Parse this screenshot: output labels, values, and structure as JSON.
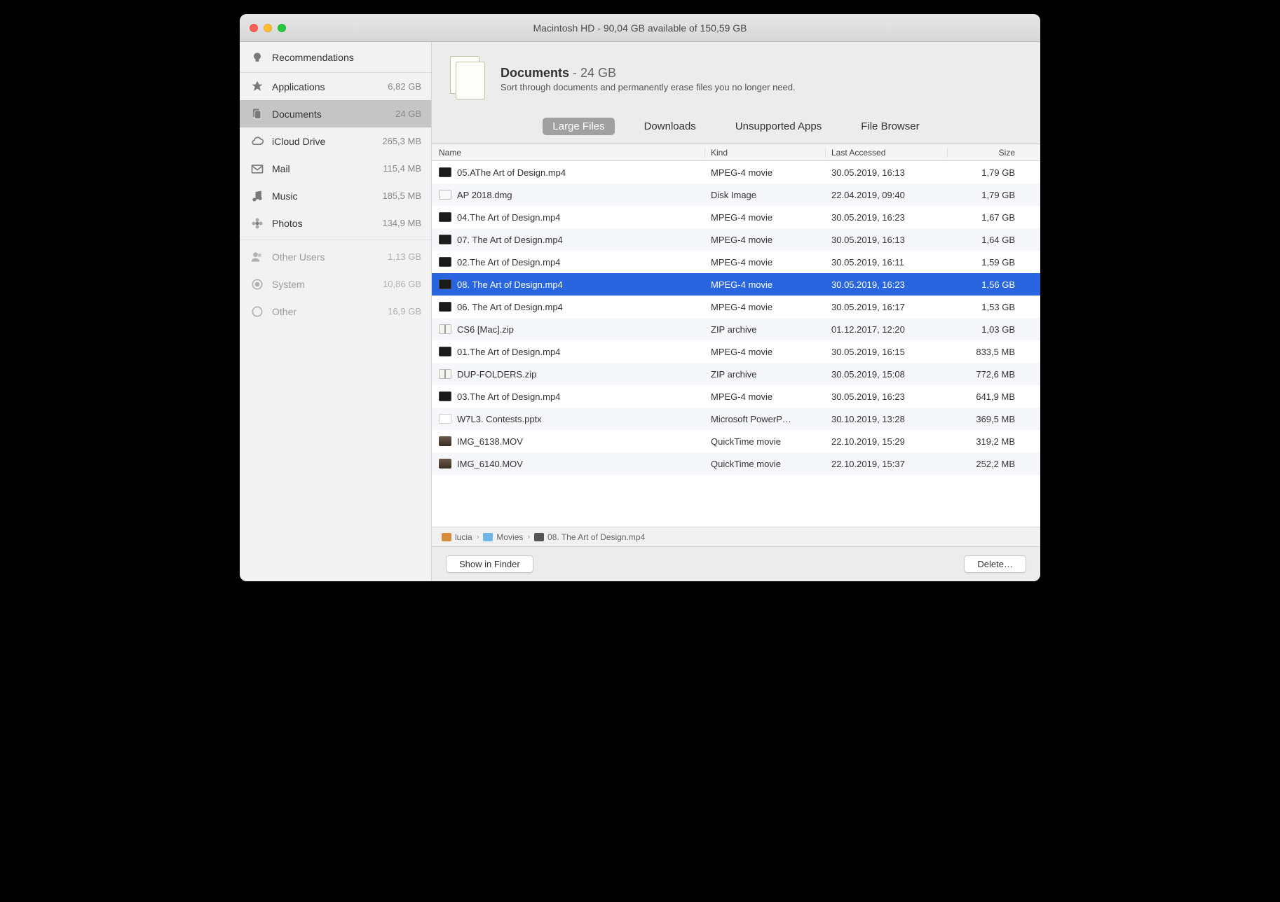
{
  "title": "Macintosh HD - 90,04 GB available of 150,59 GB",
  "sidebar": {
    "recommendations": "Recommendations",
    "items": [
      {
        "icon": "applications",
        "label": "Applications",
        "size": "6,82 GB",
        "selected": false,
        "disabled": false
      },
      {
        "icon": "documents",
        "label": "Documents",
        "size": "24 GB",
        "selected": true,
        "disabled": false
      },
      {
        "icon": "icloud",
        "label": "iCloud Drive",
        "size": "265,3 MB",
        "selected": false,
        "disabled": false
      },
      {
        "icon": "mail",
        "label": "Mail",
        "size": "115,4 MB",
        "selected": false,
        "disabled": false
      },
      {
        "icon": "music",
        "label": "Music",
        "size": "185,5 MB",
        "selected": false,
        "disabled": false
      },
      {
        "icon": "photos",
        "label": "Photos",
        "size": "134,9 MB",
        "selected": false,
        "disabled": false
      }
    ],
    "items2": [
      {
        "icon": "users",
        "label": "Other Users",
        "size": "1,13 GB",
        "disabled": true
      },
      {
        "icon": "system",
        "label": "System",
        "size": "10,86 GB",
        "disabled": true
      },
      {
        "icon": "other",
        "label": "Other",
        "size": "16,9 GB",
        "disabled": true
      }
    ]
  },
  "header": {
    "title": "Documents",
    "size": " - 24 GB",
    "desc": "Sort through documents and permanently erase files you no longer need."
  },
  "tabs": [
    "Large Files",
    "Downloads",
    "Unsupported Apps",
    "File Browser"
  ],
  "active_tab": 0,
  "columns": {
    "name": "Name",
    "kind": "Kind",
    "date": "Last Accessed",
    "size": "Size"
  },
  "files": [
    {
      "icon": "video",
      "name": "05.AThe Art of Design.mp4",
      "kind": "MPEG-4 movie",
      "date": "30.05.2019, 16:13",
      "size": "1,79 GB",
      "selected": false
    },
    {
      "icon": "dmg",
      "name": "AP 2018.dmg",
      "kind": "Disk Image",
      "date": "22.04.2019, 09:40",
      "size": "1,79 GB",
      "selected": false
    },
    {
      "icon": "video",
      "name": "04.The Art of Design.mp4",
      "kind": "MPEG-4 movie",
      "date": "30.05.2019, 16:23",
      "size": "1,67 GB",
      "selected": false
    },
    {
      "icon": "video",
      "name": "07. The Art of Design.mp4",
      "kind": "MPEG-4 movie",
      "date": "30.05.2019, 16:13",
      "size": "1,64 GB",
      "selected": false
    },
    {
      "icon": "video",
      "name": "02.The Art of Design.mp4",
      "kind": "MPEG-4 movie",
      "date": "30.05.2019, 16:11",
      "size": "1,59 GB",
      "selected": false
    },
    {
      "icon": "video",
      "name": "08. The Art of Design.mp4",
      "kind": "MPEG-4 movie",
      "date": "30.05.2019, 16:23",
      "size": "1,56 GB",
      "selected": true
    },
    {
      "icon": "video",
      "name": "06. The Art of Design.mp4",
      "kind": "MPEG-4 movie",
      "date": "30.05.2019, 16:17",
      "size": "1,53 GB",
      "selected": false
    },
    {
      "icon": "zip",
      "name": "CS6 [Mac].zip",
      "kind": "ZIP archive",
      "date": "01.12.2017, 12:20",
      "size": "1,03 GB",
      "selected": false
    },
    {
      "icon": "video",
      "name": "01.The Art of Design.mp4",
      "kind": "MPEG-4 movie",
      "date": "30.05.2019, 16:15",
      "size": "833,5 MB",
      "selected": false
    },
    {
      "icon": "zip",
      "name": "DUP-FOLDERS.zip",
      "kind": "ZIP archive",
      "date": "30.05.2019, 15:08",
      "size": "772,6 MB",
      "selected": false
    },
    {
      "icon": "video",
      "name": "03.The Art of Design.mp4",
      "kind": "MPEG-4 movie",
      "date": "30.05.2019, 16:23",
      "size": "641,9 MB",
      "selected": false
    },
    {
      "icon": "ppt",
      "name": "W7L3. Contests.pptx",
      "kind": "Microsoft PowerP…",
      "date": "30.10.2019, 13:28",
      "size": "369,5 MB",
      "selected": false
    },
    {
      "icon": "mov",
      "name": "IMG_6138.MOV",
      "kind": "QuickTime movie",
      "date": "22.10.2019, 15:29",
      "size": "319,2 MB",
      "selected": false
    },
    {
      "icon": "mov",
      "name": "IMG_6140.MOV",
      "kind": "QuickTime movie",
      "date": "22.10.2019, 15:37",
      "size": "252,2 MB",
      "selected": false
    }
  ],
  "path": [
    {
      "icon": "home",
      "label": "lucia"
    },
    {
      "icon": "folder",
      "label": "Movies"
    },
    {
      "icon": "file",
      "label": "08. The Art of Design.mp4"
    }
  ],
  "buttons": {
    "show": "Show in Finder",
    "delete": "Delete…"
  }
}
